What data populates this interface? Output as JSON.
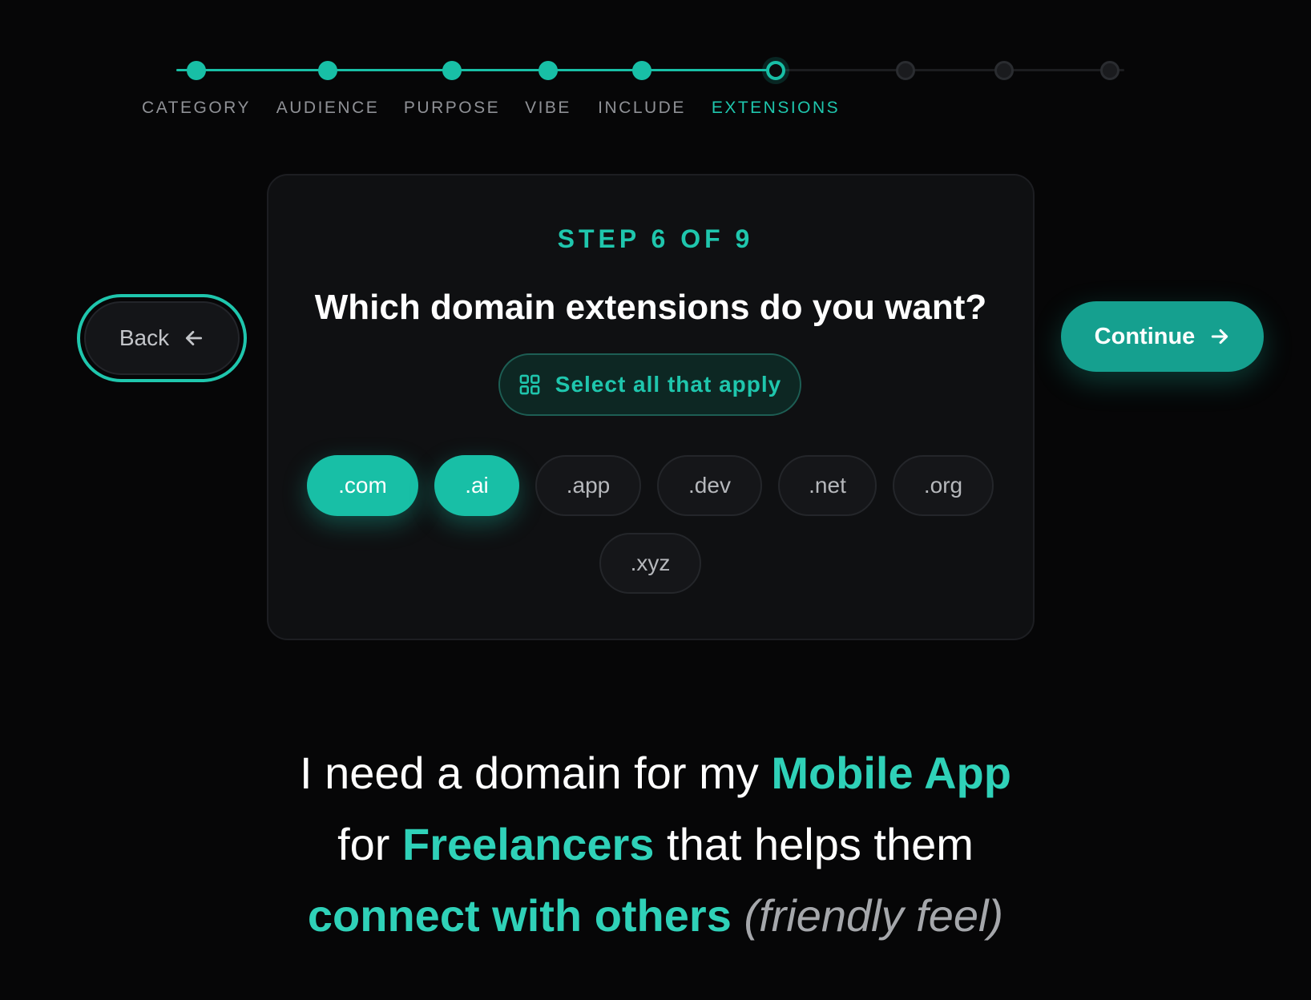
{
  "stepper": {
    "steps": [
      {
        "label": "CATEGORY",
        "state": "done"
      },
      {
        "label": "AUDIENCE",
        "state": "done"
      },
      {
        "label": "PURPOSE",
        "state": "done"
      },
      {
        "label": "VIBE",
        "state": "done"
      },
      {
        "label": "INCLUDE",
        "state": "done"
      },
      {
        "label": "EXTENSIONS",
        "state": "current"
      },
      {
        "label": "",
        "state": "todo"
      },
      {
        "label": "",
        "state": "todo"
      },
      {
        "label": "",
        "state": "todo"
      }
    ],
    "accent_color": "#18bfa6"
  },
  "card": {
    "step_counter": "STEP 6 OF 9",
    "question": "Which domain extensions do you want?",
    "hint": {
      "icon": "grid-icon",
      "text": "Select all that apply"
    },
    "extensions": [
      {
        "label": ".com",
        "selected": true
      },
      {
        "label": ".ai",
        "selected": true
      },
      {
        "label": ".app",
        "selected": false
      },
      {
        "label": ".dev",
        "selected": false
      },
      {
        "label": ".net",
        "selected": false
      },
      {
        "label": ".org",
        "selected": false
      },
      {
        "label": ".xyz",
        "selected": false
      }
    ]
  },
  "nav": {
    "back_label": "Back",
    "back_icon": "arrow-left-icon",
    "continue_label": "Continue",
    "continue_icon": "arrow-right-icon"
  },
  "summary": {
    "line1_prefix": "I need a domain for my ",
    "category": "Mobile App",
    "line2_prefix": "for ",
    "audience": "Freelancers",
    "line2_suffix": " that helps them",
    "purpose": "connect with others",
    "vibe": "(friendly feel)"
  }
}
